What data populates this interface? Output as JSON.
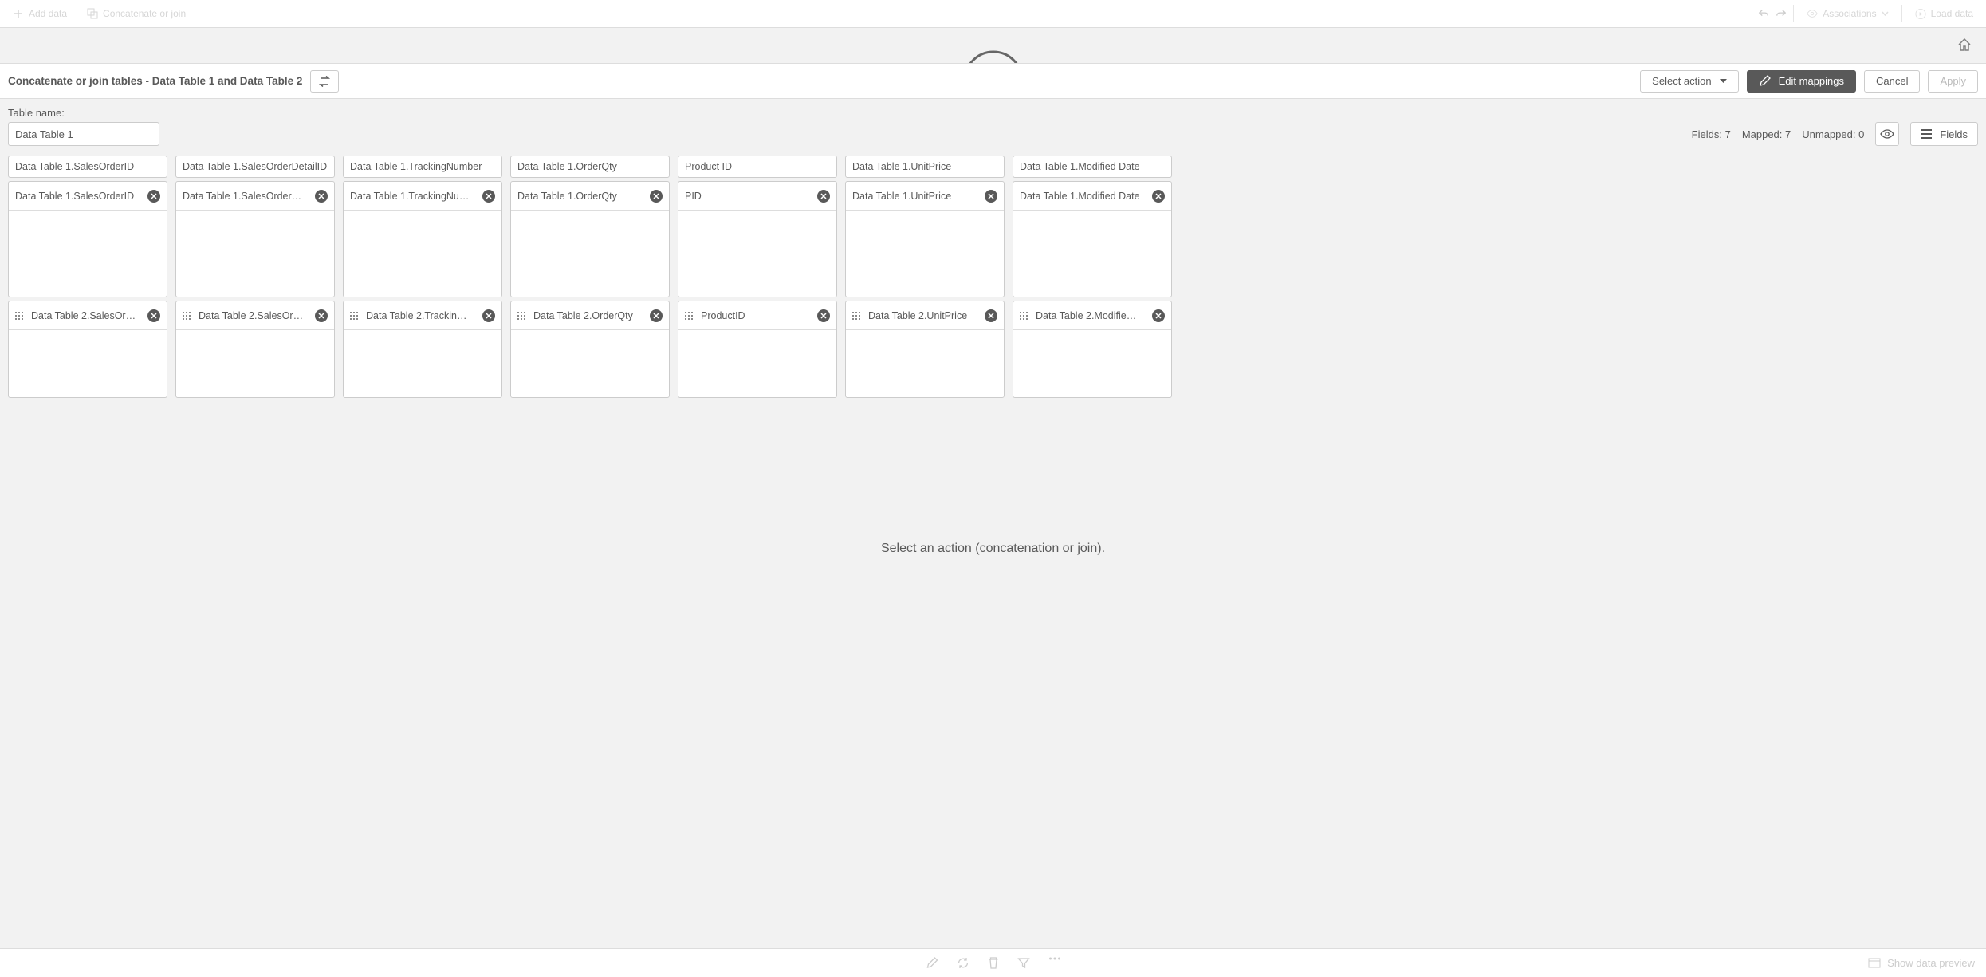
{
  "toolbar": {
    "add_data": "Add data",
    "concat_join": "Concatenate or join",
    "associations": "Associations",
    "load_data": "Load data"
  },
  "subheader": {
    "title": "Concatenate or join tables - Data Table 1 and Data Table 2",
    "select_action": "Select action",
    "edit_mappings": "Edit mappings",
    "cancel": "Cancel",
    "apply": "Apply"
  },
  "meta": {
    "table_name_label": "Table name:",
    "table_name_value": "Data Table 1",
    "fields_label": "Fields: 7",
    "mapped_label": "Mapped: 7",
    "unmapped_label": "Unmapped: 0",
    "fields_btn": "Fields"
  },
  "columns": [
    {
      "header": "Data Table 1.SalesOrderID",
      "t1": "Data Table 1.SalesOrderID",
      "t2": "Data Table 2.SalesOr…"
    },
    {
      "header": "Data Table 1.SalesOrderDetailID",
      "t1": "Data Table 1.SalesOrder…",
      "t2": "Data Table 2.SalesOr…"
    },
    {
      "header": "Data Table 1.TrackingNumber",
      "t1": "Data Table 1.TrackingNu…",
      "t2": "Data Table 2.Trackin…"
    },
    {
      "header": "Data Table 1.OrderQty",
      "t1": "Data Table 1.OrderQty",
      "t2": "Data Table 2.OrderQty"
    },
    {
      "header": "Product ID",
      "t1": "PID",
      "t2": "ProductID"
    },
    {
      "header": "Data Table 1.UnitPrice",
      "t1": "Data Table 1.UnitPrice",
      "t2": "Data Table 2.UnitPrice"
    },
    {
      "header": "Data Table 1.Modified Date",
      "t1": "Data Table 1.Modified Date",
      "t2": "Data Table 2.Modifie…"
    }
  ],
  "prompt": "Select an action (concatenation or join).",
  "footer": {
    "show_preview": "Show data preview"
  }
}
